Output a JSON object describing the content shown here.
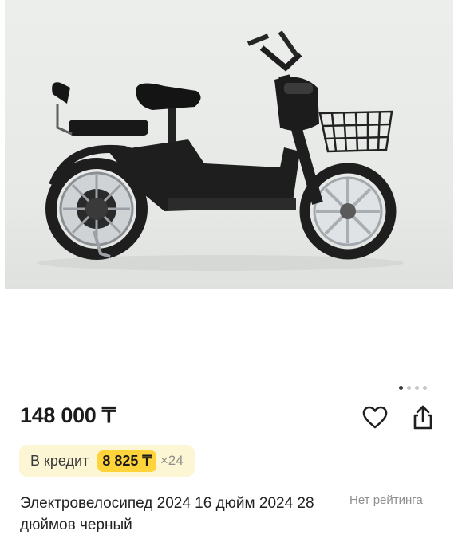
{
  "product": {
    "image_alt": "Black electric scooter-bicycle with rear seat and front basket",
    "price": "148 000 ₸",
    "title": "Электровелосипед 2024 16 дюйм 2024 28 дюймов черный",
    "rating_text": "Нет рейтинга",
    "gallery": {
      "total_dots": 4,
      "active_index": 0
    }
  },
  "credit": {
    "label": "В кредит",
    "monthly": "8 825 ₸",
    "months": "×24"
  },
  "actions": {
    "favorite_icon": "heart-icon",
    "share_icon": "share-icon"
  },
  "colors": {
    "accent_yellow": "#ffd43b",
    "credit_bg": "#fdf6d4",
    "frame_black": "#1e1e1e"
  }
}
